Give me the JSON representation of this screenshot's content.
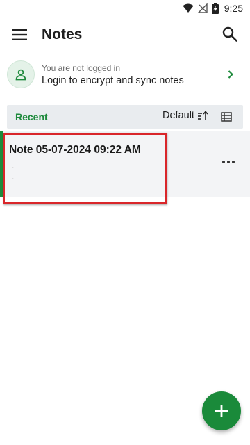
{
  "status_bar": {
    "time": "9:25",
    "icons": [
      "wifi-icon",
      "signal-off-icon",
      "battery-charging-icon"
    ]
  },
  "app_bar": {
    "title": "Notes",
    "menu_icon": "hamburger-menu-icon",
    "search_icon": "search-icon"
  },
  "login_banner": {
    "subtitle": "You are not logged in",
    "message": "Login to encrypt and sync notes",
    "icon": "person-icon",
    "chevron_icon": "chevron-right-icon"
  },
  "section": {
    "label": "Recent",
    "sort_label": "Default",
    "sort_icon": "sort-icon",
    "view_icon": "list-view-icon"
  },
  "notes": [
    {
      "title": "Note 05-07-2024 09:22 AM",
      "preview_lines": [
        "-",
        "-"
      ]
    }
  ],
  "fab": {
    "icon": "plus-icon"
  },
  "colors": {
    "accent": "#1e8a3c",
    "highlight": "#d9262a",
    "card_bg": "#f3f4f6",
    "header_bg": "#e9ecef"
  }
}
